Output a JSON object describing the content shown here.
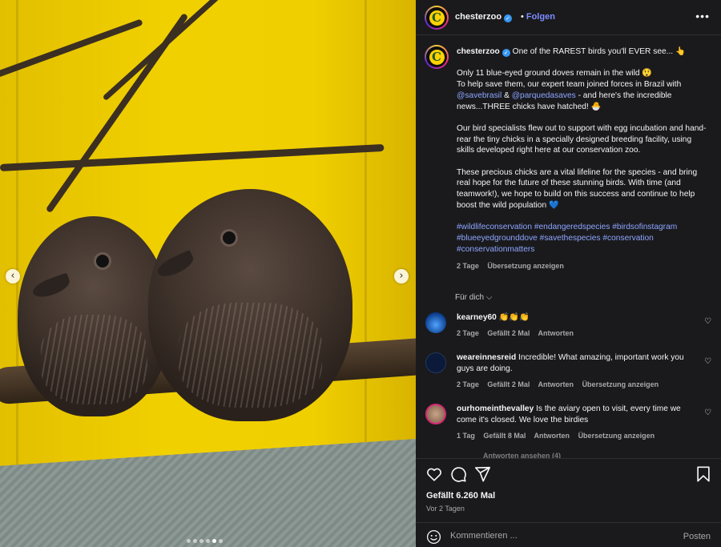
{
  "post": {
    "username": "chesterzoo",
    "follow_label": "Folgen",
    "follow_separator": "•",
    "more_label": "•••",
    "caption_first": "One of the RAREST birds you'll EVER see... 👆",
    "caption_p1a": "Only 11 blue-eyed ground doves remain in the wild 😲",
    "caption_p1b": "To help save them, our expert team joined forces in Brazil with",
    "mention1": "@savebrasil",
    "amp": "&",
    "mention2": "@parquedasaves",
    "caption_p1c": "- and here's the incredible news...THREE chicks have hatched! 🐣",
    "caption_p2": "Our bird specialists flew out to support with egg incubation and hand-rear the tiny chicks in a specially designed breeding facility, using skills developed right here at our conservation zoo.",
    "caption_p3": "These precious chicks are a vital lifeline for the species - and bring real hope for the future of these stunning birds. With time (and teamwork!), we hope to build on this success and continue to help boost the wild population 💙",
    "hashtags": "#wildlifeconservation #endangeredspecies #birdsofinstagram #blueeyedgrounddove #savethespecies #conservation #conservationmatters",
    "caption_time": "2 Tage",
    "translate_label": "Übersetzung anzeigen",
    "sort_label": "Für dich ⌵",
    "likes": "Gefällt 6.260 Mal",
    "posted_ago": "Vor 2 Tagen"
  },
  "comments": [
    {
      "username": "kearney60",
      "text": "👏👏👏",
      "time": "2 Tage",
      "likes": "Gefällt 2 Mal",
      "reply": "Antworten",
      "translate": ""
    },
    {
      "username": "weareinnesreid",
      "text": "Incredible! What amazing, important work you guys are doing.",
      "time": "2 Tage",
      "likes": "Gefällt 2 Mal",
      "reply": "Antworten",
      "translate": "Übersetzung anzeigen"
    },
    {
      "username": "ourhomeinthevalley",
      "text": "Is the aviary open to visit, every time we come it's closed. We love the birdies",
      "time": "1 Tag",
      "likes": "Gefällt 8 Mal",
      "reply": "Antworten",
      "translate": "Übersetzung anzeigen"
    }
  ],
  "more_replies": "Antworten ansehen (4)",
  "composer": {
    "placeholder": "Kommentieren ...",
    "post_label": "Posten"
  },
  "carousel": {
    "prev": "‹",
    "next": "›",
    "slide_count": 6,
    "active_index": 4
  },
  "colors": {
    "link": "#8ea6ff",
    "follow": "#7d8cff",
    "panel_bg": "#1a1a1d",
    "brand_yellow": "#ffd200"
  },
  "icons": [
    "heart-icon",
    "comment-icon",
    "share-icon",
    "bookmark-icon",
    "emoji-icon",
    "verified-icon",
    "more-icon"
  ]
}
